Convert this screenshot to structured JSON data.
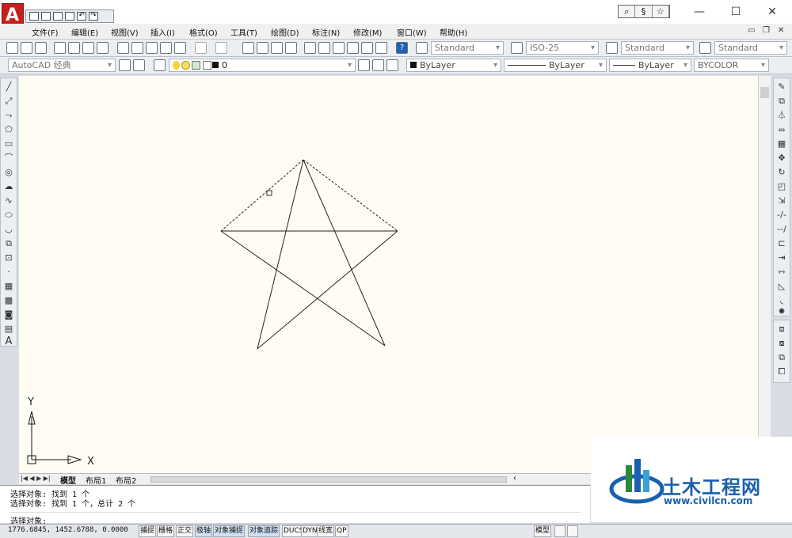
{
  "title_icons": [
    "new-icon",
    "open-icon",
    "save-icon",
    "print-icon",
    "undo-icon",
    "redo-icon"
  ],
  "window_controls": {
    "minimize": "—",
    "maximize": "☐",
    "close": "✕"
  },
  "menu": [
    "文件(F)",
    "编辑(E)",
    "视图(V)",
    "插入(I)",
    "格式(O)",
    "工具(T)",
    "绘图(D)",
    "标注(N)",
    "修改(M)",
    "窗口(W)",
    "帮助(H)"
  ],
  "toolbar": {
    "text_style": "Standard",
    "dim_style": "ISO-25",
    "table_style": "Standard",
    "multileader_style": "Standard",
    "workspace": "AutoCAD 经典",
    "layer": "0",
    "color": "ByLayer",
    "linetype": "ByLayer",
    "lineweight": "ByLayer",
    "plotstyle": "BYCOLOR"
  },
  "axis": {
    "x": "X",
    "y": "Y"
  },
  "layout_tabs": [
    "模型",
    "布局1",
    "布局2"
  ],
  "command": {
    "line1": "选择对象: 找到 1 个",
    "line2": "选择对象: 找到 1 个，总计 2 个",
    "prompt": "选择对象:"
  },
  "status": {
    "coords": "1776.6845, 1452.6788, 0.0000",
    "buttons": [
      "捕捉",
      "栅格",
      "正交",
      "极轴",
      "对象捕捉",
      "对象追踪",
      "DUCS",
      "DYN",
      "线宽",
      "QP"
    ],
    "model": "模型"
  },
  "watermark": {
    "name": "土木工程网",
    "url": "www.civilcn.com"
  },
  "colors": {
    "canvas": "#fffdf3",
    "logo": "#c81e1e",
    "wm_blue": "#1b5fb0"
  }
}
